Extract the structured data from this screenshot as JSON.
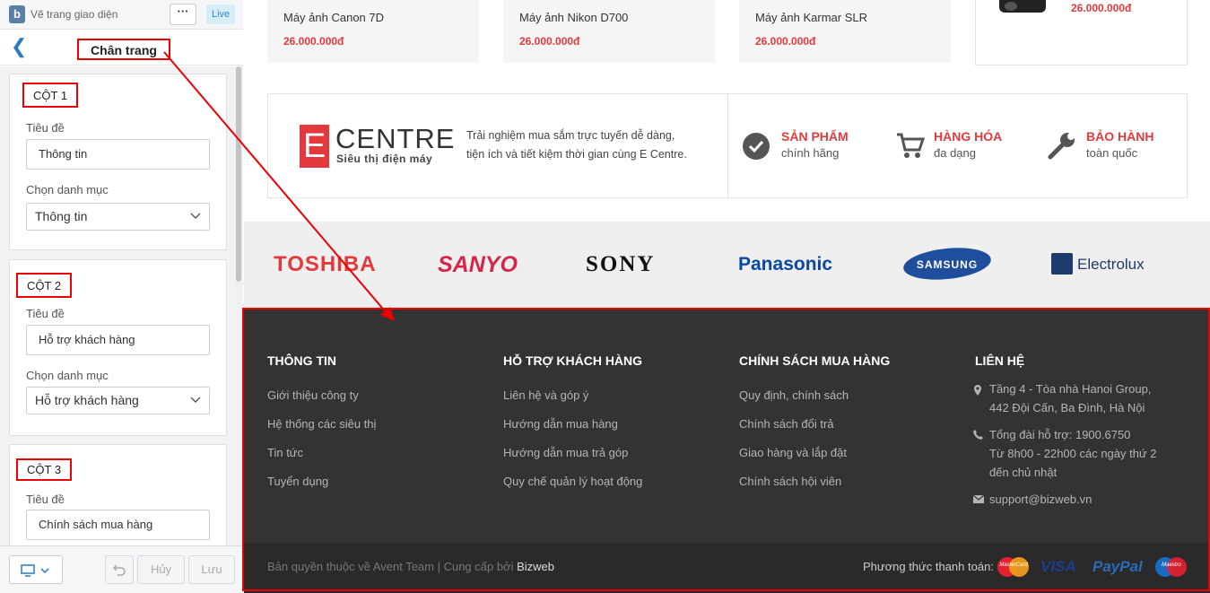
{
  "editor": {
    "theme_name": "Vẽ trang giao diện",
    "more_label": "···",
    "live_badge": "Live",
    "back_glyph": "❮",
    "section_title": "Chân trang",
    "columns": [
      {
        "label": "CỘT 1",
        "title_label": "Tiêu đề",
        "title_value": "Thông tin",
        "category_label": "Chọn danh mục",
        "category_value": "Thông tin"
      },
      {
        "label": "CỘT 2",
        "title_label": "Tiêu đề",
        "title_value": "Hỗ trợ khách hàng",
        "category_label": "Chọn danh mục",
        "category_value": "Hỗ trợ khách hàng"
      },
      {
        "label": "CỘT 3",
        "title_label": "Tiêu đề",
        "title_value": "Chính sách mua hàng"
      }
    ],
    "device_icon": "desktop-icon",
    "undo_icon": "undo-icon",
    "cancel_label": "Hủy",
    "save_label": "Lưu"
  },
  "products": [
    {
      "name": "Máy ảnh Canon 7D",
      "price": "26.000.000đ"
    },
    {
      "name": "Máy ảnh Nikon D700",
      "price": "26.000.000đ"
    },
    {
      "name": "Máy ảnh Karmar SLR",
      "price": "26.000.000đ"
    },
    {
      "name": "",
      "price": "26.000.000đ"
    }
  ],
  "info_band": {
    "logo_letter": "E",
    "logo_word": "CENTRE",
    "logo_sub": "Siêu thị điện máy",
    "intro_line1": "Trải nghiệm mua sắm trực tuyến dễ dàng,",
    "intro_line2": "tiện ích và tiết kiệm thời gian cùng E Centre.",
    "features": [
      {
        "icon": "check-circle-icon",
        "title": "SẢN PHẨM",
        "subtitle": "chính hãng"
      },
      {
        "icon": "cart-icon",
        "title": "HÀNG HÓA",
        "subtitle": "đa dạng"
      },
      {
        "icon": "wrench-icon",
        "title": "BẢO HÀNH",
        "subtitle": "toàn quốc"
      }
    ]
  },
  "brands": [
    "TOSHIBA",
    "SANYO",
    "SONY",
    "Panasonic",
    "SAMSUNG",
    "Electrolux"
  ],
  "footer": {
    "columns": [
      {
        "title": "THÔNG TIN",
        "links": [
          "Giới thiệu công ty",
          "Hệ thống các siêu thị",
          "Tin tức",
          "Tuyển dụng"
        ]
      },
      {
        "title": "HỖ TRỢ KHÁCH HÀNG",
        "links": [
          "Liên hệ và góp ý",
          "Hướng dẫn mua hàng",
          "Hướng dẫn mua trả góp",
          "Quy chế quản lý hoạt động"
        ]
      },
      {
        "title": "CHÍNH SÁCH MUA HÀNG",
        "links": [
          "Quy định, chính sách",
          "Chính sách đổi trả",
          "Giao hàng và lắp đặt",
          "Chính sách hội viên"
        ]
      }
    ],
    "contact": {
      "title": "LIÊN HỆ",
      "address_line1": "Tầng 4 - Tòa nhà Hanoi Group,",
      "address_line2": "442 Đội Cấn, Ba Đình, Hà Nội",
      "hotline_line1": "Tổng đài hỗ trợ: 1900.6750",
      "hotline_line2": "Từ 8h00 - 22h00 các ngày thứ 2",
      "hotline_line3": "đến chủ nhật",
      "email": "support@bizweb.vn"
    },
    "copyright_text": "Bản quyền thuộc về Avent Team | Cung cấp bởi ",
    "copyright_link": "Bizweb",
    "payment_label": "Phương thức thanh toán:",
    "payment_methods": [
      "MasterCard",
      "VISA",
      "PayPal",
      "Maestro"
    ]
  },
  "colors": {
    "accent": "#e4393c",
    "editor_link": "#2a7ac2",
    "annotation": "#e00000",
    "footer_bg": "#333333"
  }
}
